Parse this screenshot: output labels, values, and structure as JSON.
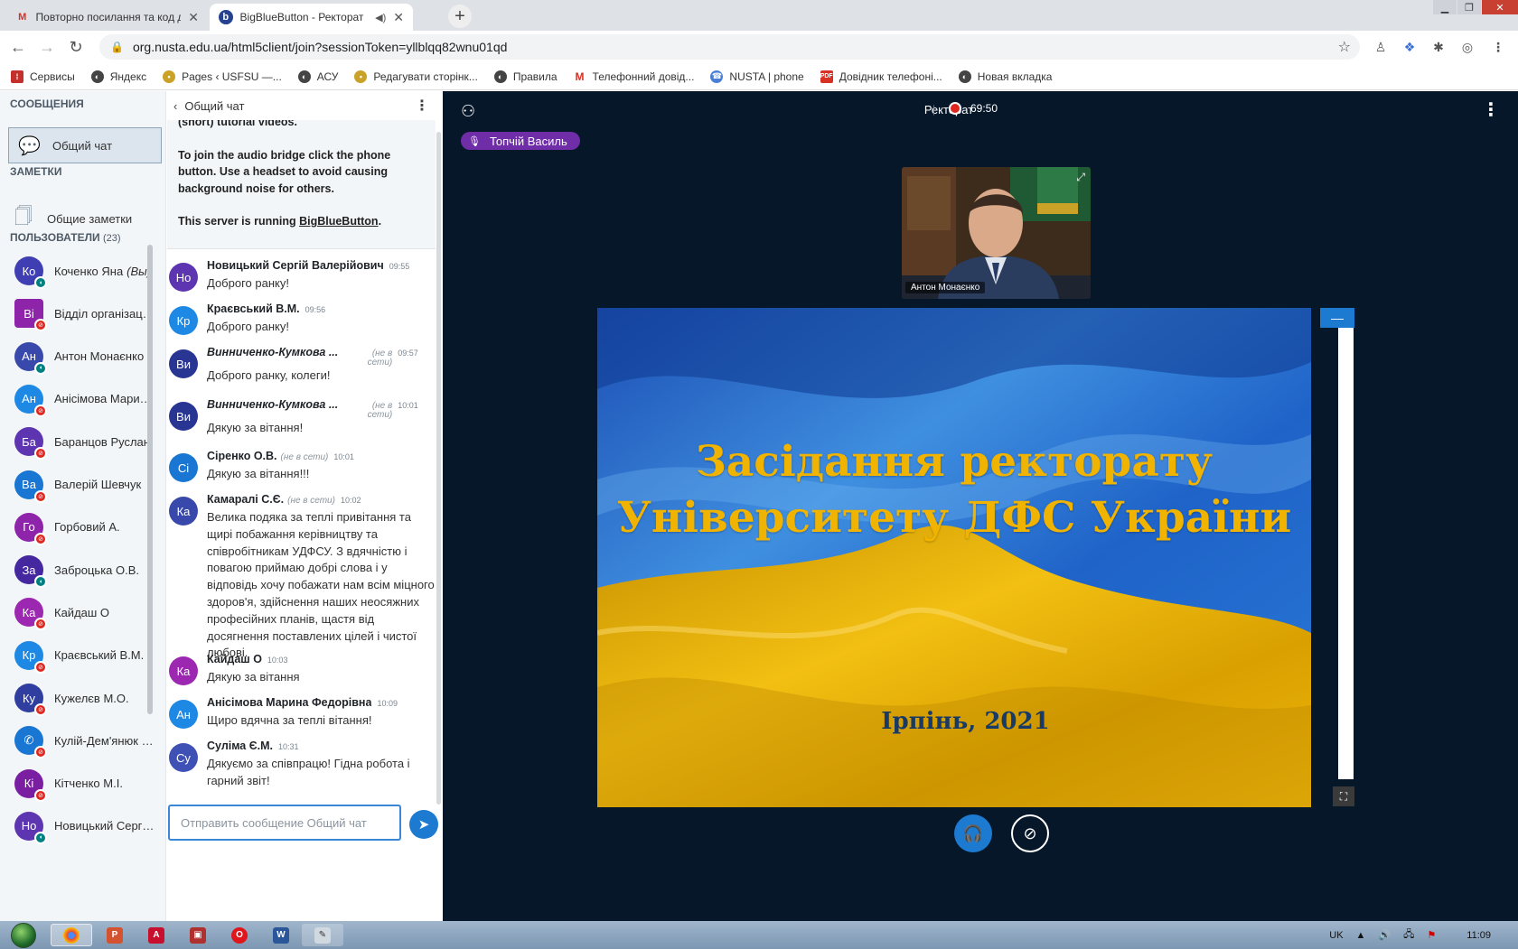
{
  "browser": {
    "tabs": [
      {
        "title": "Повторно посилання та код дос",
        "icon": "gmail-icon",
        "active": false
      },
      {
        "title": "BigBlueButton - Ректорат",
        "icon": "bigbluebutton-icon",
        "active": true
      }
    ],
    "url": "org.nusta.edu.ua/html5client/join?sessionToken=yllblqq82wnu01qd",
    "bookmarks": [
      {
        "label": "Сервисы",
        "color": "#c4302b"
      },
      {
        "label": "Яндекс",
        "color": "#444444"
      },
      {
        "label": "Pages ‹ USFSU —...",
        "color": "#c9a227"
      },
      {
        "label": "АСУ",
        "color": "#444444"
      },
      {
        "label": "Редагувати сторінк...",
        "color": "#c9a227"
      },
      {
        "label": "Правила",
        "color": "#444444"
      },
      {
        "label": "Телефонний довід...",
        "color": "#d93025"
      },
      {
        "label": "NUSTA | phone",
        "color": "#4a7fd8"
      },
      {
        "label": "Довідник телефоні...",
        "color": "#d93025"
      },
      {
        "label": "Новая вкладка",
        "color": "#444444"
      }
    ]
  },
  "sidebar": {
    "messages_header": "СООБЩЕНИЯ",
    "public_chat_label": "Общий чат",
    "notes_header": "ЗАМЕТКИ",
    "shared_notes_label": "Общие заметки",
    "users_header": "ПОЛЬЗОВАТЕЛИ",
    "users_count": "(23)",
    "users": [
      {
        "initials": "Ко",
        "name": "Коченко Яна",
        "you": "(Вы)",
        "color": "#3f3eb2",
        "badge": "live",
        "square": false
      },
      {
        "initials": "Ві",
        "name": "Відділ організації ...",
        "you": "",
        "color": "#8e24aa",
        "badge": "mute",
        "square": true
      },
      {
        "initials": "Ан",
        "name": "Антон Монаєнко",
        "you": "",
        "color": "#3949ab",
        "badge": "live",
        "square": false
      },
      {
        "initials": "Ан",
        "name": "Анісімова Марин...",
        "you": "",
        "color": "#1e88e5",
        "badge": "mute",
        "square": false
      },
      {
        "initials": "Ба",
        "name": "Баранцов Руслан",
        "you": "",
        "color": "#5e35b1",
        "badge": "mute",
        "square": false
      },
      {
        "initials": "Ва",
        "name": "Валерій Шевчук",
        "you": "",
        "color": "#1976d2",
        "badge": "mute",
        "square": false
      },
      {
        "initials": "Го",
        "name": "Горбовий А.",
        "you": "",
        "color": "#8e24aa",
        "badge": "mute",
        "square": false
      },
      {
        "initials": "За",
        "name": "Заброцька О.В.",
        "you": "",
        "color": "#4527a0",
        "badge": "live",
        "square": false
      },
      {
        "initials": "Ка",
        "name": "Кайдаш О",
        "you": "",
        "color": "#9c27b0",
        "badge": "mute",
        "square": false
      },
      {
        "initials": "Кр",
        "name": "Краєвський В.М.",
        "you": "",
        "color": "#1e88e5",
        "badge": "mute",
        "square": false
      },
      {
        "initials": "Ку",
        "name": "Кужелєв М.О.",
        "you": "",
        "color": "#303f9f",
        "badge": "mute",
        "square": false
      },
      {
        "initials": "✆",
        "name": "Кулій-Дем'янюк Ю.",
        "you": "",
        "color": "#1976d2",
        "badge": "mute",
        "square": false
      },
      {
        "initials": "Кі",
        "name": "Кітченко М.І.",
        "you": "",
        "color": "#7b1fa2",
        "badge": "mute",
        "square": false
      },
      {
        "initials": "Но",
        "name": "Новицький Сергій...",
        "you": "",
        "color": "#5e35b1",
        "badge": "live",
        "square": false
      }
    ]
  },
  "chat": {
    "title": "Общий чат",
    "welcome_partial": "(short) tutorial videos.",
    "welcome_audio": "To join the audio bridge click the phone button. Use a headset to avoid causing background noise for others.",
    "welcome_server_prefix": "This server is running ",
    "welcome_server_link": "BigBlueButton",
    "welcome_server_suffix": ".",
    "messages": [
      {
        "initials": "Но",
        "color": "#5e35b1",
        "name": "Новицький Сергій Валерійович",
        "offline": "",
        "time": "09:55",
        "text": "Доброго ранку!",
        "italic": false
      },
      {
        "initials": "Кр",
        "color": "#1e88e5",
        "name": "Краєвський В.М.",
        "offline": "",
        "time": "09:56",
        "text": "Доброго ранку!",
        "italic": false
      },
      {
        "initials": "Ви",
        "color": "#283593",
        "name": "Винниченко-Кумкова ...",
        "offline": "(не в сети)",
        "time": "09:57",
        "text": "Доброго ранку, колеги!",
        "italic": true
      },
      {
        "initials": "Ви",
        "color": "#283593",
        "name": "Винниченко-Кумкова ...",
        "offline": "(не в сети)",
        "time": "10:01",
        "text": "Дякую за вітання!",
        "italic": true
      },
      {
        "initials": "Сі",
        "color": "#1976d2",
        "name": "Сіренко О.В.",
        "offline": "(не в сети)",
        "time": "10:01",
        "text": "Дякую за вітання!!!",
        "italic": false
      },
      {
        "initials": "Ка",
        "color": "#3949ab",
        "name": "Камаралі С.Є.",
        "offline": "(не в сети)",
        "time": "10:02",
        "text": "Велика подяка за теплі привітання та щирі побажання керівництву та співробітникам УДФСУ. З вдячністю і повагою приймаю добрі слова і у відповідь хочу побажати нам всім міцного здоров'я, здійснення наших неосяжних професійних планів, щастя від досягнення поставлених цілей і чистої любові.",
        "italic": false
      },
      {
        "initials": "Ка",
        "color": "#9c27b0",
        "name": "Кайдаш О",
        "offline": "",
        "time": "10:03",
        "text": "Дякую за вітання",
        "italic": false
      },
      {
        "initials": "Ан",
        "color": "#1e88e5",
        "name": "Анісімова Марина Федорівна",
        "offline": "",
        "time": "10:09",
        "text": "Щиро вдячна за теплі вітання!",
        "italic": false
      },
      {
        "initials": "Су",
        "color": "#3f51b5",
        "name": "Суліма Є.М.",
        "offline": "",
        "time": "10:31",
        "text": "Дякуємо за співпрацю! Гідна робота і гарний звіт!",
        "italic": false
      }
    ],
    "input_placeholder": "Отправить сообщение Общий чат"
  },
  "stage": {
    "meeting_title": "Ректорат",
    "recording_time": "69:50",
    "talking_user": "Топчій Василь",
    "webcam_name": "Антон Монаєнко",
    "slide_title_line1": "Засідання ректорату",
    "slide_title_line2": "Університету ДФС України",
    "slide_subtitle": "Ірпінь, 2021"
  },
  "taskbar": {
    "language": "UK",
    "clock": "11:09"
  }
}
